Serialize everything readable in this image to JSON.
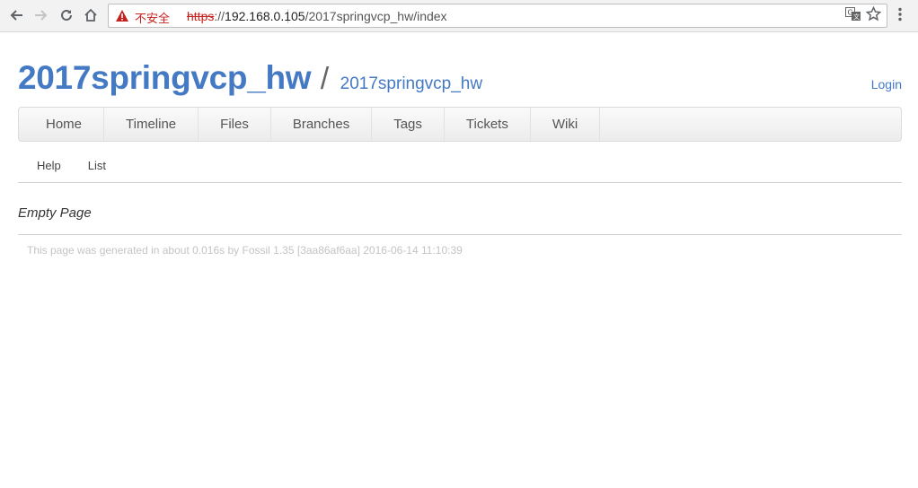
{
  "browser": {
    "security_label": "不安全",
    "url_scheme": "https",
    "url_sep": "://",
    "url_host": "192.168.0.105",
    "url_path": "/2017springvcp_hw/index",
    "icons": [
      "back-icon",
      "forward-icon",
      "reload-icon",
      "home-icon",
      "warning-icon",
      "translate-icon",
      "star-icon",
      "menu-icon"
    ]
  },
  "header": {
    "project_name": "2017springvcp_hw",
    "separator": "/",
    "subtitle": "2017springvcp_hw",
    "login": "Login"
  },
  "mainmenu": {
    "items": [
      "Home",
      "Timeline",
      "Files",
      "Branches",
      "Tags",
      "Tickets",
      "Wiki"
    ]
  },
  "submenu": {
    "items": [
      "Help",
      "List"
    ]
  },
  "content": {
    "text": "Empty Page"
  },
  "footer": {
    "text": "This page was generated in about 0.016s by Fossil 1.35 [3aa86af6aa] 2016-06-14 11:10:39"
  },
  "colors": {
    "accent": "#4479c4",
    "warning": "#c5221f",
    "footer_text": "#c4c4c4"
  }
}
